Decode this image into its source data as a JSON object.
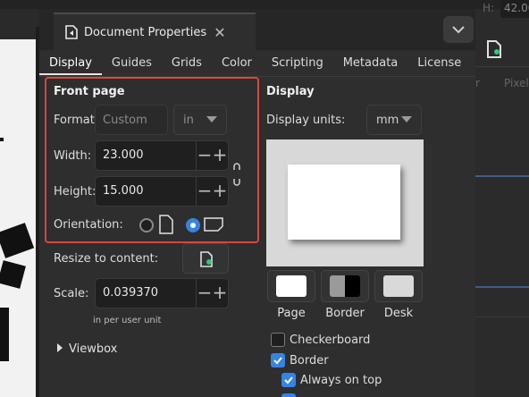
{
  "background": {
    "right_panel": {
      "h_label": "H:",
      "h_value": "42.00",
      "unit_label": "Pixel",
      "side_label": "r"
    }
  },
  "dialog": {
    "tab_title": "Document Properties",
    "close_glyph": "✕",
    "tabs": [
      "Display",
      "Guides",
      "Grids",
      "Color",
      "Scripting",
      "Metadata",
      "License"
    ],
    "active_tab": "Display"
  },
  "front_page": {
    "title": "Front page",
    "format_label": "Format:",
    "format_value": "Custom",
    "format_unit": "in",
    "width_label": "Width:",
    "width_value": "23.000",
    "height_label": "Height:",
    "height_value": "15.000",
    "orientation_label": "Orientation:",
    "orientation_selected": "landscape"
  },
  "resize": {
    "label": "Resize to content:"
  },
  "scale": {
    "label": "Scale:",
    "value": "0.039370",
    "note": "in  per user unit"
  },
  "viewbox": {
    "label": "Viewbox"
  },
  "display": {
    "title": "Display",
    "units_label": "Display units:",
    "units_value": "mm",
    "swatches": [
      {
        "label": "Page",
        "color": "#ffffff"
      },
      {
        "label": "Border",
        "color": "#000000"
      },
      {
        "label": "Desk",
        "color": "#d9d9d9"
      }
    ],
    "checkboxes": [
      {
        "label": "Checkerboard",
        "checked": false
      },
      {
        "label": "Border",
        "checked": true
      },
      {
        "label": "Always on top",
        "checked": true
      }
    ]
  },
  "colors": {
    "accent": "#3584e4",
    "highlight_box": "#d9473b"
  }
}
